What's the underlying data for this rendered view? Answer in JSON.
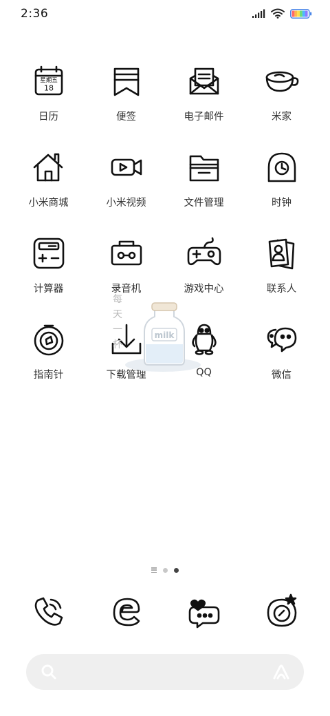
{
  "status_bar": {
    "time": "2:36",
    "icons": [
      "signal-icon",
      "wifi-icon",
      "battery-icon"
    ],
    "battery_colors": [
      "#ff6a6a",
      "#ffb84d",
      "#ffe04d",
      "#6ddc7b",
      "#4db8ff",
      "#8a7dff"
    ]
  },
  "apps": [
    {
      "label": "日历",
      "icon": "calendar-icon",
      "icon_text_top": "星期五",
      "icon_text_bottom": "18"
    },
    {
      "label": "便签",
      "icon": "notes-icon"
    },
    {
      "label": "电子邮件",
      "icon": "email-icon"
    },
    {
      "label": "米家",
      "icon": "mijia-icon"
    },
    {
      "label": "小米商城",
      "icon": "store-icon"
    },
    {
      "label": "小米视频",
      "icon": "video-icon"
    },
    {
      "label": "文件管理",
      "icon": "folder-icon"
    },
    {
      "label": "时钟",
      "icon": "clock-icon"
    },
    {
      "label": "计算器",
      "icon": "calculator-icon"
    },
    {
      "label": "录音机",
      "icon": "recorder-icon"
    },
    {
      "label": "游戏中心",
      "icon": "gamepad-icon"
    },
    {
      "label": "联系人",
      "icon": "contacts-icon"
    },
    {
      "label": "指南针",
      "icon": "compass-icon"
    },
    {
      "label": "下载管理",
      "icon": "download-icon"
    },
    {
      "label": "QQ",
      "icon": "qq-penguin-icon"
    },
    {
      "label": "微信",
      "icon": "wechat-icon"
    }
  ],
  "widget": {
    "vertical_text": "每天一杯",
    "jar_label": "milk",
    "colors": {
      "lid": "#f0e6d6",
      "milk": "#e3eef8",
      "shadow": "#e9eef3"
    }
  },
  "page_indicator": {
    "pages": 3,
    "current": 3
  },
  "dock": [
    {
      "icon": "phone-icon"
    },
    {
      "icon": "browser-icon"
    },
    {
      "icon": "messages-icon"
    },
    {
      "icon": "camera-icon"
    }
  ],
  "search": {
    "icons": [
      "search-icon",
      "assistant-icon"
    ],
    "background": "#efefef"
  }
}
